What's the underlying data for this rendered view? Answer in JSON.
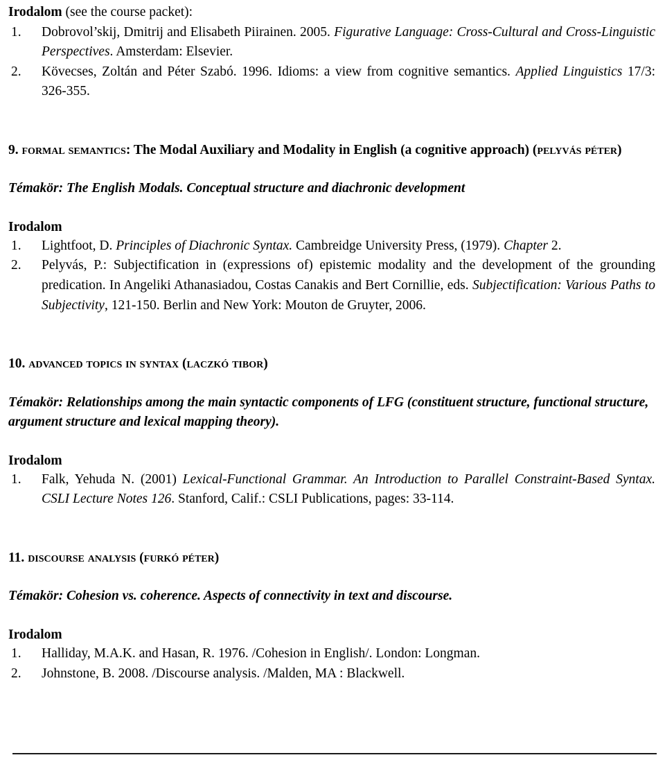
{
  "document": {
    "top_block": {
      "heading_bold": "Irodalom",
      "heading_rest": " (see the course packet):",
      "items": [
        {
          "num": "1.",
          "parts": [
            {
              "t": "Dobrovol’skij, Dmitrij and Elisabeth Piirainen. 2005. ",
              "s": "roman"
            },
            {
              "t": "Figurative Language: Cross-Cultural and Cross-Linguistic Perspectives",
              "s": "italic"
            },
            {
              "t": ". Amsterdam: Elsevier.",
              "s": "roman"
            }
          ]
        },
        {
          "num": "2.",
          "parts": [
            {
              "t": "Kövecses, Zoltán and Péter Szabó. 1996. Idioms: a view from cognitive semantics. ",
              "s": "roman"
            },
            {
              "t": "Applied Linguistics",
              "s": "italic"
            },
            {
              "t": " 17/3: 326-355.",
              "s": "roman"
            }
          ]
        }
      ]
    },
    "sections": [
      {
        "number": "9.",
        "title_smallcaps": "Formal semantics",
        "title_rest": ": The Modal Auxiliary and Modality in English (a cognitive approach) (",
        "author_smallcaps": "Pelyvás Péter",
        "title_close": ")",
        "temakor_label": "Témakör:",
        "temakor_text": " The English Modals. Conceptual structure and diachronic development",
        "irodalom_label": "Irodalom",
        "references": [
          {
            "num": "1.",
            "parts": [
              {
                "t": "Lightfoot, D. ",
                "s": "roman"
              },
              {
                "t": "Principles of Diachronic Syntax.",
                "s": "italic"
              },
              {
                "t": " Cambreidge University Press, (1979). ",
                "s": "roman"
              },
              {
                "t": "Chapter",
                "s": "italic"
              },
              {
                "t": " 2.",
                "s": "roman"
              }
            ]
          },
          {
            "num": "2.",
            "parts": [
              {
                "t": "Pelyvás, P.: Subjectification in (expressions of) epistemic modality and the development of the grounding predication. In Angeliki Athanasiadou, Costas Canakis and Bert Cornillie, eds. ",
                "s": "roman"
              },
              {
                "t": "Subjectification: Various Paths to Subjectivity",
                "s": "italic"
              },
              {
                "t": ", 121-150. Berlin and New York: Mouton de Gruyter, 2006.",
                "s": "roman"
              }
            ]
          }
        ]
      },
      {
        "number": "10.",
        "title_smallcaps": "Advanced topics in syntax",
        "title_rest": " (",
        "author_smallcaps": "Laczkó Tibor",
        "title_close": ")",
        "temakor_label": "Témakör:",
        "temakor_text": " Relationships among the main syntactic components of LFG (constituent structure, functional structure, argument structure and lexical mapping theory).",
        "irodalom_label": "Irodalom",
        "references": [
          {
            "num": "1.",
            "parts": [
              {
                "t": "Falk, Yehuda N. (2001) ",
                "s": "roman"
              },
              {
                "t": "Lexical-Functional Grammar. An Introduction to Parallel Constraint-Based Syntax.",
                "s": "italic"
              },
              {
                "t": " ",
                "s": "roman"
              },
              {
                "t": "CSLI Lecture Notes 126",
                "s": "italic"
              },
              {
                "t": ". Stanford, Calif.: CSLI Publications, pages: 33-114.",
                "s": "roman"
              }
            ]
          }
        ]
      },
      {
        "number": "11.",
        "title_smallcaps": "Discourse Analysis",
        "title_rest": " (",
        "author_smallcaps": "Furkó Péter",
        "title_close": ")",
        "temakor_label": "Témakör:",
        "temakor_text": " Cohesion vs. coherence. Aspects of connectivity in text and discourse.",
        "irodalom_label": "Irodalom",
        "references": [
          {
            "num": "1.",
            "parts": [
              {
                "t": "Halliday, M.A.K. and Hasan, R. 1976. /Cohesion in English/. London: Longman.",
                "s": "roman"
              }
            ]
          },
          {
            "num": "2.",
            "parts": [
              {
                "t": "Johnstone, B. 2008. /Discourse analysis. /Malden, MA : Blackwell.",
                "s": "roman"
              }
            ]
          }
        ]
      }
    ]
  }
}
